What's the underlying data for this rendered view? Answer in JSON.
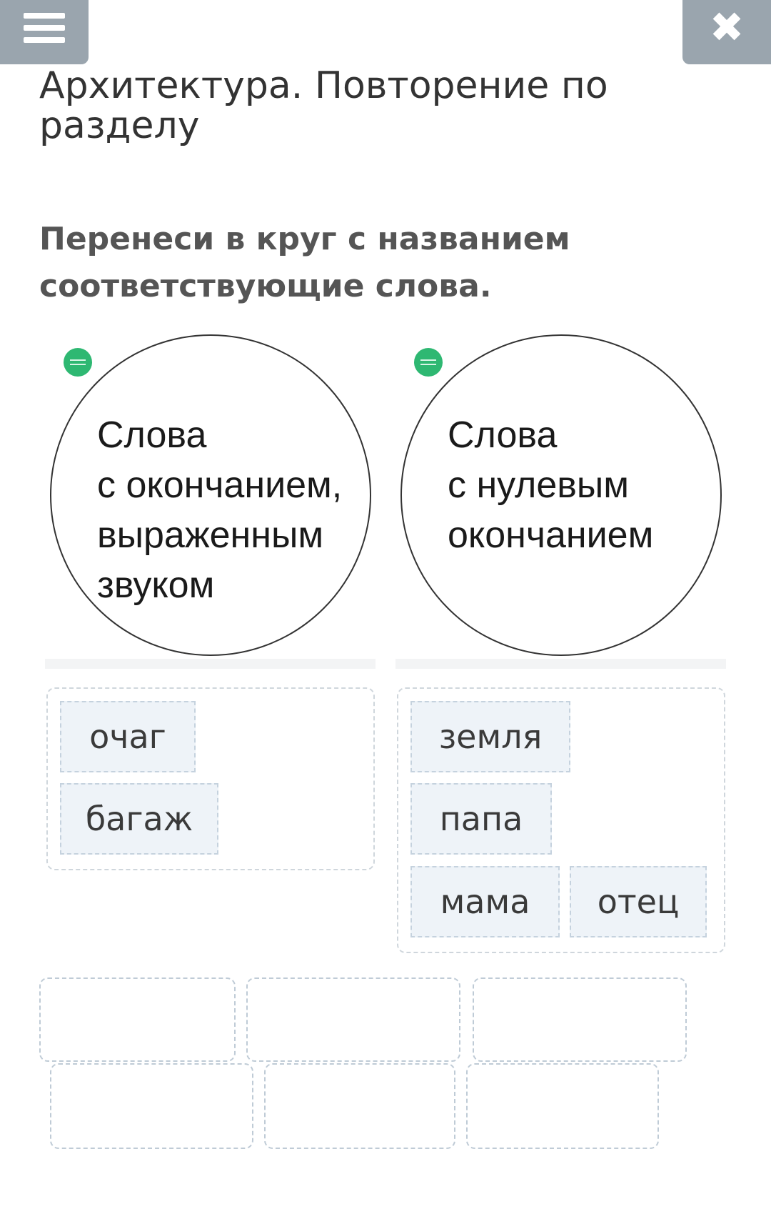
{
  "header": {
    "menu_icon": "hamburger-menu-icon",
    "close_icon": "close-x-icon",
    "close_glyph": "✖"
  },
  "title": "Архитектура. Повторение по разделу",
  "instruction": "Перенеси в круг с названием соответствующие слова.",
  "circles": [
    {
      "label": "Слова\nс окончанием,\nвыраженным\nзвуком",
      "logo_icon": "blumland-logo-icon"
    },
    {
      "label": "Слова\nс нулевым\nокончанием",
      "logo_icon": "blumland-logo-icon"
    }
  ],
  "zones": [
    {
      "words": [
        "очаг",
        "багаж"
      ]
    },
    {
      "words": [
        "земля",
        "папа",
        "мама",
        "отец"
      ]
    }
  ],
  "empty_slots_count": 6,
  "colors": {
    "top_button_bg": "#9aa5ae",
    "chip_bg": "#eef3f8",
    "logo_green": "#2eb872"
  }
}
